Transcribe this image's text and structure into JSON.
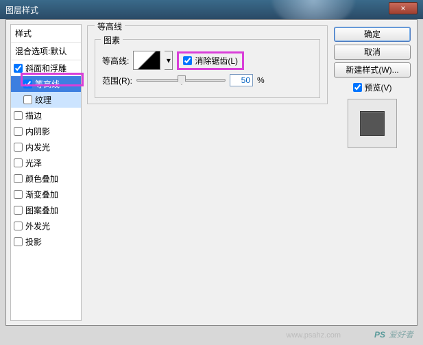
{
  "title": "图层样式",
  "close_glyph": "×",
  "sidebar": {
    "header": "样式",
    "blend": "混合选项:默认",
    "items": [
      {
        "label": "斜面和浮雕",
        "checked": true
      },
      {
        "label": "等高线",
        "checked": true
      },
      {
        "label": "纹理",
        "checked": false
      },
      {
        "label": "描边",
        "checked": false
      },
      {
        "label": "内阴影",
        "checked": false
      },
      {
        "label": "内发光",
        "checked": false
      },
      {
        "label": "光泽",
        "checked": false
      },
      {
        "label": "颜色叠加",
        "checked": false
      },
      {
        "label": "渐变叠加",
        "checked": false
      },
      {
        "label": "图案叠加",
        "checked": false
      },
      {
        "label": "外发光",
        "checked": false
      },
      {
        "label": "投影",
        "checked": false
      }
    ]
  },
  "main": {
    "section_title": "等高线",
    "elements_title": "图素",
    "contour_label": "等高线:",
    "antialias_label": "消除锯齿(L)",
    "range_label": "范围(R):",
    "range_value": "50",
    "range_unit": "%",
    "dd_glyph": "▾"
  },
  "buttons": {
    "ok": "确定",
    "cancel": "取消",
    "new_style": "新建样式(W)...",
    "preview": "预览(V)"
  },
  "watermark": {
    "brand_a": "PS",
    "brand_b": "爱好者",
    "url": "www.psahz.com"
  }
}
